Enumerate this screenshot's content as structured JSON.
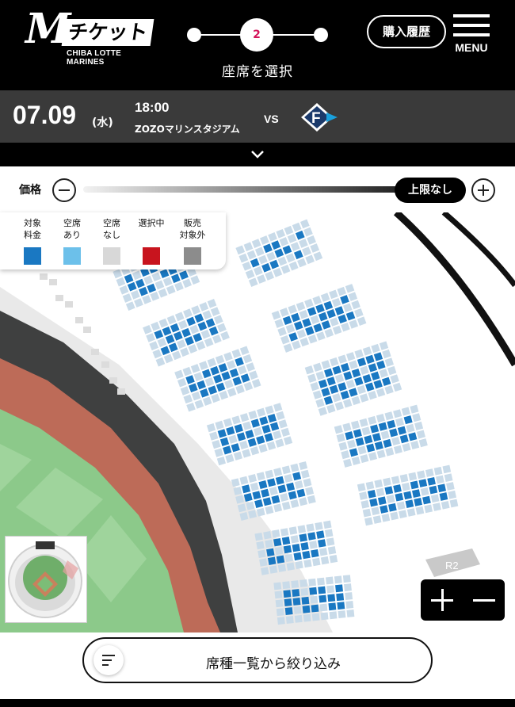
{
  "header": {
    "logo_mark": "M",
    "logo_kana": "チケット",
    "logo_sub": "CHIBA LOTTE MARINES",
    "current_step": "2",
    "step_label": "座席を選択",
    "history_label": "購入履歴",
    "menu_label": "MENU"
  },
  "game": {
    "date": "07.09",
    "weekday": "(水)",
    "time": "18:00",
    "venue": "ZOZOマリンスタジアム",
    "vs": "VS",
    "opponent_logo_letter": "F"
  },
  "price_filter": {
    "label": "価格",
    "max_label": "上限なし"
  },
  "legend": [
    {
      "label_1": "対象",
      "label_2": "料金",
      "color": "#1a78c2"
    },
    {
      "label_1": "空席",
      "label_2": "あり",
      "color": "#6cc0ea"
    },
    {
      "label_1": "空席",
      "label_2": "なし",
      "color": "#d8d8d8"
    },
    {
      "label_1": "選択中",
      "label_2": "",
      "color": "#c8141e"
    },
    {
      "label_1": "販売",
      "label_2": "対象外",
      "color": "#8c8c8c"
    }
  ],
  "map": {
    "section_label": "R2",
    "colors": {
      "seat_target": "#1a78c2",
      "seat_sold": "#c9dbe9",
      "field": "#8cc98a",
      "warning_track": "#bd6b58",
      "stand_dark": "#3f4040"
    }
  },
  "bottom": {
    "filter_label": "席種一覧から絞り込み"
  }
}
